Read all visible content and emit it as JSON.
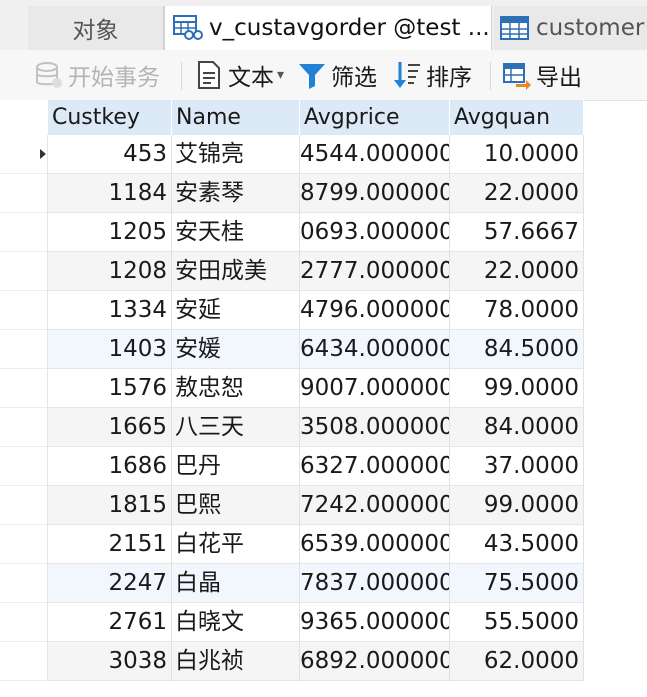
{
  "tabs": {
    "objects": "对象",
    "active": "v_custavgorder @test ...",
    "customer": "customer"
  },
  "toolbar": {
    "begin_transaction": "开始事务",
    "text": "文本",
    "filter": "筛选",
    "sort": "排序",
    "export": "导出"
  },
  "table": {
    "columns": [
      "Custkey",
      "Name",
      "Avgprice",
      "Avgquan"
    ],
    "rows": [
      {
        "custkey": "453",
        "name": "艾锦亮",
        "avgprice": "4544.000000",
        "avgquan": "10.0000"
      },
      {
        "custkey": "1184",
        "name": "安素琴",
        "avgprice": "8799.000000",
        "avgquan": "22.0000"
      },
      {
        "custkey": "1205",
        "name": "安天桂",
        "avgprice": "0693.000000",
        "avgquan": "57.6667"
      },
      {
        "custkey": "1208",
        "name": "安田成美",
        "avgprice": "2777.000000",
        "avgquan": "22.0000"
      },
      {
        "custkey": "1334",
        "name": "安延",
        "avgprice": "4796.000000",
        "avgquan": "78.0000"
      },
      {
        "custkey": "1403",
        "name": "安媛",
        "avgprice": "6434.000000",
        "avgquan": "84.5000"
      },
      {
        "custkey": "1576",
        "name": "敖忠恕",
        "avgprice": "9007.000000",
        "avgquan": "99.0000"
      },
      {
        "custkey": "1665",
        "name": "八三天",
        "avgprice": "3508.000000",
        "avgquan": "84.0000"
      },
      {
        "custkey": "1686",
        "name": "巴丹",
        "avgprice": "6327.000000",
        "avgquan": "37.0000"
      },
      {
        "custkey": "1815",
        "name": "巴熙",
        "avgprice": "7242.000000",
        "avgquan": "99.0000"
      },
      {
        "custkey": "2151",
        "name": "白花平",
        "avgprice": "6539.000000",
        "avgquan": "43.5000"
      },
      {
        "custkey": "2247",
        "name": "白晶",
        "avgprice": "7837.000000",
        "avgquan": "75.5000"
      },
      {
        "custkey": "2761",
        "name": "白晓文",
        "avgprice": "9365.000000",
        "avgquan": "55.5000"
      },
      {
        "custkey": "3038",
        "name": "白兆祯",
        "avgprice": "6892.000000",
        "avgquan": "62.0000"
      }
    ]
  }
}
